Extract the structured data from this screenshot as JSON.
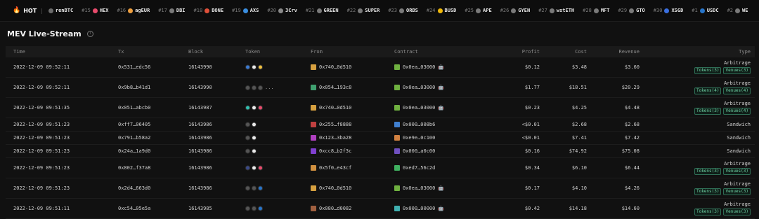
{
  "header": {
    "hot_label": "HOT",
    "ticker": [
      {
        "rank": "",
        "name": "renBTC",
        "color": "#6b6b6b"
      },
      {
        "rank": "#15",
        "name": "HEX",
        "color": "#e84b6c"
      },
      {
        "rank": "#16",
        "name": "agEUR",
        "color": "#f0a040"
      },
      {
        "rank": "#17",
        "name": "DBI",
        "color": "#7a7a7a"
      },
      {
        "rank": "#18",
        "name": "BONE",
        "color": "#e0503a"
      },
      {
        "rank": "#19",
        "name": "AXS",
        "color": "#3a8ee0"
      },
      {
        "rank": "#20",
        "name": "3Crv",
        "color": "#8a8a8a"
      },
      {
        "rank": "#21",
        "name": "GREEN",
        "color": "#7a7a7a"
      },
      {
        "rank": "#22",
        "name": "SUPER",
        "color": "#7a7a7a"
      },
      {
        "rank": "#23",
        "name": "ORBS",
        "color": "#7a7a7a"
      },
      {
        "rank": "#24",
        "name": "BUSD",
        "color": "#f0b90b"
      },
      {
        "rank": "#25",
        "name": "APE",
        "color": "#7a7a7a"
      },
      {
        "rank": "#26",
        "name": "GYEN",
        "color": "#7a7a7a"
      },
      {
        "rank": "#27",
        "name": "wstETH",
        "color": "#7a7a7a"
      },
      {
        "rank": "#28",
        "name": "MFT",
        "color": "#7a7a7a"
      },
      {
        "rank": "#29",
        "name": "GTO",
        "color": "#7a7a7a"
      },
      {
        "rank": "#30",
        "name": "XSGD",
        "color": "#3a6fe0"
      },
      {
        "rank": "#1",
        "name": "USDC",
        "color": "#2775ca"
      },
      {
        "rank": "#2",
        "name": "WE",
        "color": "#7a7a7a"
      }
    ]
  },
  "page": {
    "title": "MEV Live-Stream",
    "info_icon": "info-icon"
  },
  "table": {
    "columns": [
      "Time",
      "Tx",
      "Block",
      "Token",
      "From",
      "Contract",
      "Profit",
      "Cost",
      "Revenue",
      "Type"
    ],
    "rows": [
      {
        "time": "2022-12-09 09:52:11",
        "tx": "0x531…edc56",
        "block": "16143990",
        "tokens": [
          "#3a7bd5",
          "#e8e8e8",
          "#f0c040"
        ],
        "more": "",
        "from_color": "#d6a040",
        "from": "0x740…0d510",
        "contract_color": "#6fb040",
        "contract": "0x0ea…03000",
        "bot": "🤖",
        "profit": "$0.12",
        "cost": "$3.48",
        "revenue": "$3.60",
        "type": "Arbitrage",
        "tokens_badge": "Tokens(3)",
        "venues_badge": "Venues(3)",
        "tall": true
      },
      {
        "time": "2022-12-09 09:52:11",
        "tx": "0x9b8…b41d1",
        "block": "16143990",
        "tokens": [
          "#555555",
          "#555555",
          "#555555"
        ],
        "more": "...",
        "from_color": "#40a070",
        "from": "0x054…193c8",
        "contract_color": "#6fb040",
        "contract": "0x0ea…03000",
        "bot": "🤖",
        "profit": "$1.77",
        "cost": "$18.51",
        "revenue": "$20.29",
        "type": "Arbitrage",
        "tokens_badge": "Tokens(4)",
        "venues_badge": "Venues(4)",
        "tall": true
      },
      {
        "time": "2022-12-09 09:51:35",
        "tx": "0x051…abcb0",
        "block": "16143987",
        "tokens": [
          "#30c0b0",
          "#e8e8e8",
          "#e84b6c"
        ],
        "more": "",
        "from_color": "#d6a040",
        "from": "0x740…0d510",
        "contract_color": "#6fb040",
        "contract": "0x0ea…03000",
        "bot": "🤖",
        "profit": "$0.23",
        "cost": "$4.25",
        "revenue": "$4.48",
        "type": "Arbitrage",
        "tokens_badge": "Tokens(3)",
        "venues_badge": "Venues(4)",
        "tall": true
      },
      {
        "time": "2022-12-09 09:51:23",
        "tx": "0xff7…06405",
        "block": "16143986",
        "tokens": [
          "#555555",
          "#e8e8e8"
        ],
        "more": "",
        "from_color": "#c04040",
        "from": "0x255…f8888",
        "contract_color": "#4080d0",
        "contract": "0x000…008b6",
        "bot": "",
        "profit": "<$0.01",
        "cost": "$2.68",
        "revenue": "$2.68",
        "type": "Sandwich",
        "tokens_badge": "",
        "venues_badge": "",
        "tall": false
      },
      {
        "time": "2022-12-09 09:51:23",
        "tx": "0x791…b58a2",
        "block": "16143986",
        "tokens": [
          "#555555",
          "#e8e8e8"
        ],
        "more": "",
        "from_color": "#b040c0",
        "from": "0x123…3ba28",
        "contract_color": "#d08040",
        "contract": "0xe9e…0c100",
        "bot": "",
        "profit": "<$0.01",
        "cost": "$7.41",
        "revenue": "$7.42",
        "type": "Sandwich",
        "tokens_badge": "",
        "venues_badge": "",
        "tall": false
      },
      {
        "time": "2022-12-09 09:51:23",
        "tx": "0x24a…1a9d0",
        "block": "16143986",
        "tokens": [
          "#555555",
          "#e8e8e8"
        ],
        "more": "",
        "from_color": "#8040d0",
        "from": "0xcc8…b2f3c",
        "contract_color": "#7050c0",
        "contract": "0x000…a0c00",
        "bot": "",
        "profit": "$0.16",
        "cost": "$74.92",
        "revenue": "$75.08",
        "type": "Sandwich",
        "tokens_badge": "",
        "venues_badge": "",
        "tall": false
      },
      {
        "time": "2022-12-09 09:51:23",
        "tx": "0x802…f37a8",
        "block": "16143986",
        "tokens": [
          "#3a4a8a",
          "#e8e8e8",
          "#e84b6c"
        ],
        "more": "",
        "from_color": "#d09040",
        "from": "0x5f0…e43cf",
        "contract_color": "#40b060",
        "contract": "0xed7…56c2d",
        "bot": "",
        "profit": "$0.34",
        "cost": "$6.10",
        "revenue": "$6.44",
        "type": "Arbitrage",
        "tokens_badge": "Tokens(3)",
        "venues_badge": "Venues(3)",
        "tall": true
      },
      {
        "time": "2022-12-09 09:51:23",
        "tx": "0x2d4…663d0",
        "block": "16143986",
        "tokens": [
          "#555555",
          "#555555",
          "#2775ca"
        ],
        "more": "",
        "from_color": "#d6a040",
        "from": "0x740…0d510",
        "contract_color": "#6fb040",
        "contract": "0x0ea…03000",
        "bot": "🤖",
        "profit": "$0.17",
        "cost": "$4.10",
        "revenue": "$4.26",
        "type": "Arbitrage",
        "tokens_badge": "Tokens(3)",
        "venues_badge": "Venues(3)",
        "tall": true
      },
      {
        "time": "2022-12-09 09:51:11",
        "tx": "0xc54…05e5a",
        "block": "16143985",
        "tokens": [
          "#555555",
          "#555555",
          "#2775ca"
        ],
        "more": "",
        "from_color": "#a06040",
        "from": "0x080…d0082",
        "contract_color": "#40b0b0",
        "contract": "0x000…00000",
        "bot": "🤖",
        "profit": "$0.42",
        "cost": "$14.18",
        "revenue": "$14.60",
        "type": "Arbitrage",
        "tokens_badge": "Tokens(3)",
        "venues_badge": "Venues(3)",
        "tall": true
      }
    ]
  }
}
